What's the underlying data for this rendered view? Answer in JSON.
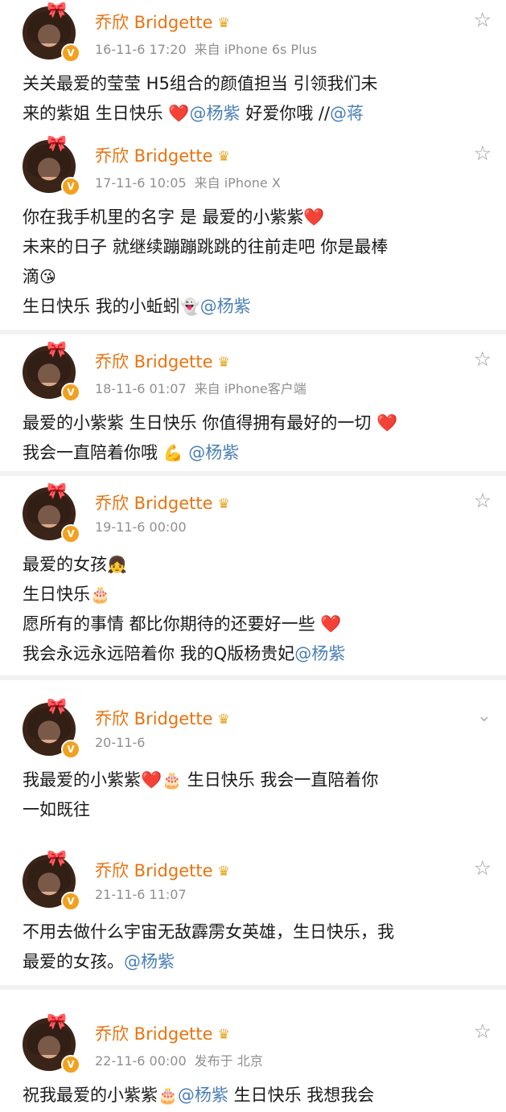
{
  "posts": [
    {
      "name": "乔欣 Bridgette",
      "time": "16-11-6 17:20",
      "source": "来自 iPhone 6s Plus",
      "corner_icon": "star-outline",
      "lines": [
        {
          "t": "关关最爱的莹莹  H5组合的颜值担当 引领我们未"
        },
        {
          "t": "来的紫姐 生日快乐 ",
          "m": "@杨紫",
          "a": " 好爱你哦 ",
          "h": "❤️",
          "z": " //",
          "m2": "@蒋"
        }
      ]
    },
    {
      "name": "乔欣 Bridgette",
      "time": "17-11-6 10:05",
      "source": "来自 iPhone X",
      "corner_icon": "star-outline",
      "lines": [
        {
          "t": "你在我手机里的名字 是 最爱的小紫紫",
          "h": "❤️"
        },
        {
          "t": "未来的日子 就继续蹦蹦跳跳的往前走吧 你是最棒"
        },
        {
          "t": "滴",
          "e": "😘"
        },
        {
          "t": "生日快乐 我的小蚯蚓",
          "e": "👻",
          "m": "@杨紫"
        }
      ]
    },
    {
      "name": "乔欣 Bridgette",
      "time": "18-11-6 01:07",
      "source": "来自 iPhone客户端",
      "corner_icon": "star-outline",
      "lines": [
        {
          "t": "最爱的小紫紫 生日快乐 你值得拥有最好的一切 ",
          "h": "❤️"
        },
        {
          "t": "我会一直陪着你哦 ",
          "e": "💪",
          "m": " @杨紫"
        }
      ]
    },
    {
      "name": "乔欣 Bridgette",
      "time": "19-11-6 00:00",
      "source": "",
      "corner_icon": "star-outline",
      "lines": [
        {
          "t": "最爱的女孩",
          "e": "👧"
        },
        {
          "t": "生日快乐",
          "e": "🎂"
        },
        {
          "t": "愿所有的事情 都比你期待的还要好一些 ",
          "h": "❤️"
        },
        {
          "t": "我会永远永远陪着你 我的Q版杨贵妃",
          "m": "@杨紫"
        }
      ]
    },
    {
      "name": "乔欣 Bridgette",
      "time": "20-11-6",
      "source": "",
      "corner_icon": "chevron-down",
      "lines": [
        {
          "t": "我最爱的小紫紫",
          "h": "❤️",
          "a": " 生日快乐 ",
          "e": "🎂",
          "z": " 我会一直陪着你"
        },
        {
          "t": "一如既往"
        }
      ]
    },
    {
      "name": "乔欣 Bridgette",
      "time": "21-11-6 11:07",
      "source": "",
      "corner_icon": "star-outline",
      "lines": [
        {
          "t": "不用去做什么宇宙无敌霹雳女英雄，生日快乐，我"
        },
        {
          "t": "最爱的女孩。",
          "m": "@杨紫"
        }
      ]
    },
    {
      "name": "乔欣 Bridgette",
      "time": "22-11-6 00:00",
      "source": "发布于 北京",
      "corner_icon": "star-outline",
      "lines": [
        {
          "t": "祝我最爱的小紫紫",
          "m": "@杨紫",
          "a": " 生日快乐 ",
          "e": "🎂",
          "z": " 我想我会"
        }
      ]
    }
  ],
  "icons": {
    "star-outline": "☆",
    "chevron-down": "⌄",
    "crown": "♛",
    "avatar-deco": "🎀"
  },
  "colors": {
    "name": "#e8730f",
    "mention": "#4a7fb6",
    "meta": "#8f8f8f",
    "heart": "#e02020",
    "verified": "#f2a11f"
  }
}
